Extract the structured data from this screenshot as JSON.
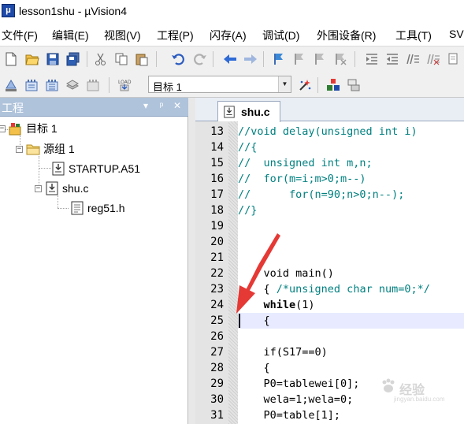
{
  "window": {
    "title": "lesson1shu  - µVision4"
  },
  "menu": {
    "items": [
      "文件(F)",
      "编辑(E)",
      "视图(V)",
      "工程(P)",
      "闪存(A)",
      "调试(D)",
      "外围设备(R)",
      "工具(T)",
      "SVC"
    ]
  },
  "toolbar": {
    "target_select": {
      "value": "目标 1"
    }
  },
  "project_panel": {
    "title": "工程",
    "header_buttons": [
      "▾",
      "ᵖ",
      "✕"
    ],
    "tree": [
      {
        "label": "目标 1",
        "kind": "target",
        "expander": "−"
      },
      {
        "label": "源组 1",
        "kind": "group",
        "expander": "−"
      },
      {
        "label": "STARTUP.A51",
        "kind": "asm-file",
        "expander": ""
      },
      {
        "label": "shu.c",
        "kind": "c-file",
        "expander": "−"
      },
      {
        "label": "reg51.h",
        "kind": "header-file",
        "expander": ""
      }
    ]
  },
  "editor": {
    "tab_label": "shu.c",
    "current_line": 25,
    "lines": [
      {
        "n": 13,
        "tokens": [
          {
            "t": "//void delay(unsigned int i)",
            "c": "com"
          }
        ]
      },
      {
        "n": 14,
        "tokens": [
          {
            "t": "//{",
            "c": "com"
          }
        ]
      },
      {
        "n": 15,
        "tokens": [
          {
            "t": "//  unsigned int m,n;",
            "c": "com"
          }
        ]
      },
      {
        "n": 16,
        "tokens": [
          {
            "t": "//  for(m=i;m>0;m--)",
            "c": "com"
          }
        ]
      },
      {
        "n": 17,
        "tokens": [
          {
            "t": "//      for(n=90;n>0;n--);",
            "c": "com"
          }
        ]
      },
      {
        "n": 18,
        "tokens": [
          {
            "t": "//}",
            "c": "com"
          }
        ]
      },
      {
        "n": 19,
        "tokens": []
      },
      {
        "n": 20,
        "tokens": []
      },
      {
        "n": 21,
        "tokens": []
      },
      {
        "n": 22,
        "tokens": [
          {
            "t": "    ",
            "c": "txt"
          },
          {
            "t": "void main()",
            "c": "txt"
          }
        ]
      },
      {
        "n": 23,
        "tokens": [
          {
            "t": "    { ",
            "c": "txt"
          },
          {
            "t": "/*unsigned char num=0;*/",
            "c": "com"
          }
        ]
      },
      {
        "n": 24,
        "tokens": [
          {
            "t": "    ",
            "c": "txt"
          },
          {
            "t": "while",
            "c": "kw"
          },
          {
            "t": "(1)",
            "c": "txt"
          }
        ]
      },
      {
        "n": 25,
        "tokens": [
          {
            "t": "    {",
            "c": "txt"
          }
        ]
      },
      {
        "n": 26,
        "tokens": []
      },
      {
        "n": 27,
        "tokens": [
          {
            "t": "    if(S17==0)",
            "c": "txt"
          }
        ]
      },
      {
        "n": 28,
        "tokens": [
          {
            "t": "    {",
            "c": "txt"
          }
        ]
      },
      {
        "n": 29,
        "tokens": [
          {
            "t": "    P0=tablewei[0];",
            "c": "txt"
          }
        ]
      },
      {
        "n": 30,
        "tokens": [
          {
            "t": "    wela=1;wela=0;",
            "c": "txt"
          }
        ]
      },
      {
        "n": 31,
        "tokens": [
          {
            "t": "    P0=table[1];",
            "c": "txt"
          }
        ]
      }
    ]
  },
  "watermark": {
    "text": "经验",
    "url": "jingyan.baidu.com"
  },
  "colors": {
    "comment": "#008080",
    "current_line": "#e8ebff",
    "panel_header": "#afc3db",
    "arrow": "#e53935"
  }
}
